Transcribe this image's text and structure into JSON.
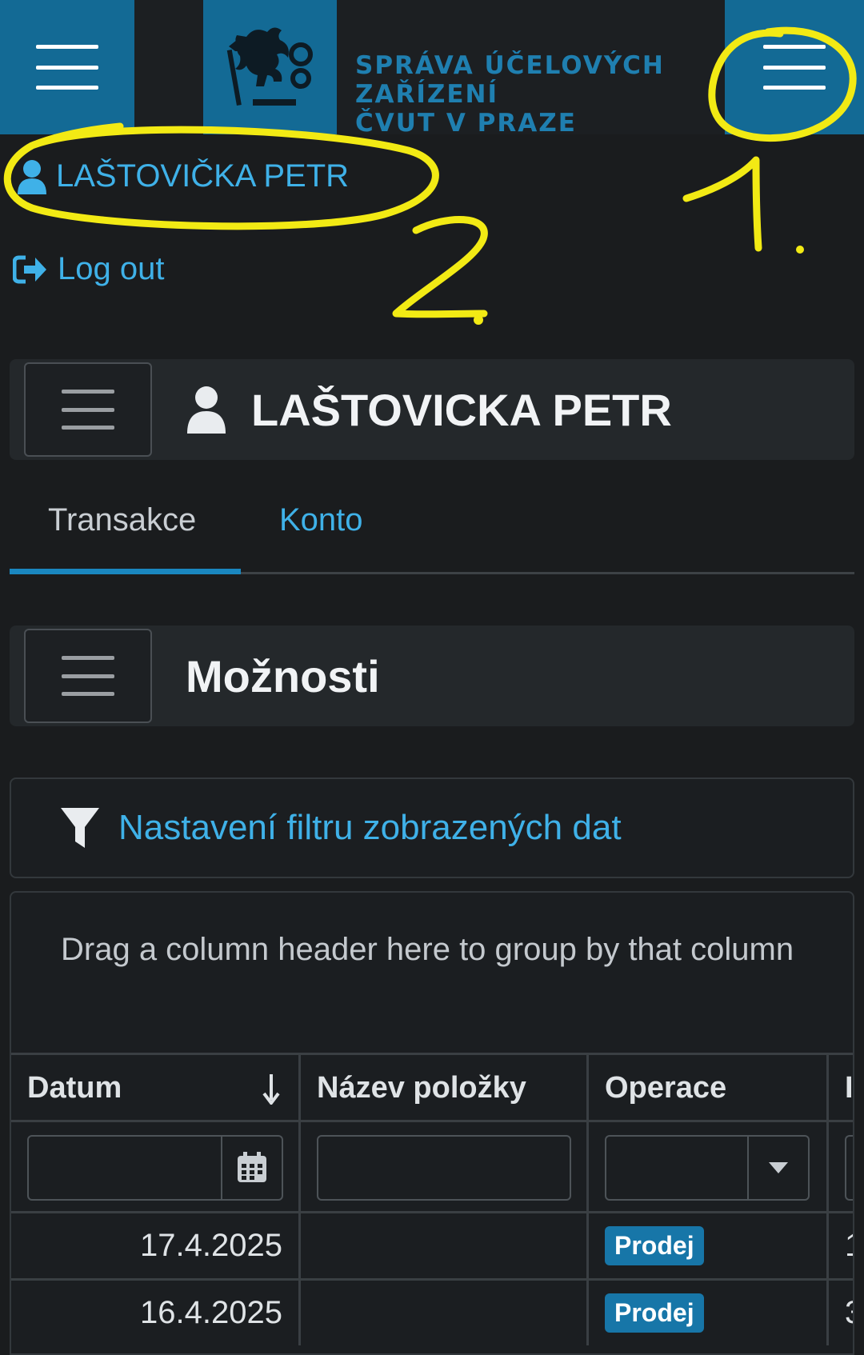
{
  "header": {
    "logo_lines": [
      "SPRÁVA ÚČELOVÝCH",
      "ZAŘÍZENÍ",
      "ČVUT V PRAZE"
    ],
    "left_menu_icon": "hamburger-icon",
    "right_menu_icon": "hamburger-icon",
    "brand_color": "#136a95"
  },
  "user": {
    "name": "LAŠTOVIČKA PETR",
    "icon": "user-icon"
  },
  "logout": {
    "label": "Log out",
    "icon": "sign-out-icon"
  },
  "annotations": {
    "label_1": "1.",
    "label_2": "2.",
    "color": "#f2ea14"
  },
  "profile_panel": {
    "title": "LAŠTOVICKA PETR",
    "icon": "user-icon"
  },
  "tabs": [
    {
      "label": "Transakce",
      "active": true
    },
    {
      "label": "Konto",
      "active": false
    }
  ],
  "options_panel": {
    "title": "Možnosti"
  },
  "filter": {
    "label": "Nastavení filtru zobrazených dat",
    "icon": "filter-icon"
  },
  "grid": {
    "group_hint": "Drag a column header here to group by that column",
    "columns": [
      "Datum",
      "Název položky",
      "Operace",
      "I"
    ],
    "sort": {
      "column": "Datum",
      "direction": "descending"
    },
    "rows": [
      {
        "date": "17.4.2025",
        "item": "",
        "operation": "Prodej",
        "next": "1"
      },
      {
        "date": "16.4.2025",
        "item": "",
        "operation": "Prodej",
        "next": "3"
      }
    ]
  }
}
